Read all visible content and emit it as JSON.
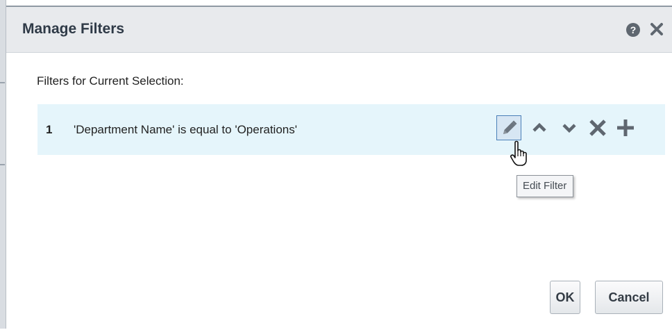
{
  "dialog": {
    "title": "Manage Filters",
    "help_icon": "?",
    "icons": {
      "help": "help-circle-icon",
      "close": "close-icon"
    }
  },
  "filters": {
    "section_label": "Filters for Current Selection:",
    "items": [
      {
        "number": "1",
        "text": "'Department Name' is equal to 'Operations'"
      }
    ],
    "actions": [
      {
        "name": "edit",
        "icon": "pencil-icon"
      },
      {
        "name": "move-up",
        "icon": "chevron-up-icon"
      },
      {
        "name": "move-down",
        "icon": "chevron-down-icon"
      },
      {
        "name": "remove",
        "icon": "x-icon"
      },
      {
        "name": "add",
        "icon": "plus-icon"
      }
    ]
  },
  "tooltip": {
    "text": "Edit Filter"
  },
  "footer": {
    "ok_label": "OK",
    "cancel_label": "Cancel"
  },
  "colors": {
    "header_bg": "#e8eaed",
    "row_bg": "#e5f5fb",
    "icon_gray": "#5f6770",
    "edit_focus": "#4a7fb8"
  }
}
